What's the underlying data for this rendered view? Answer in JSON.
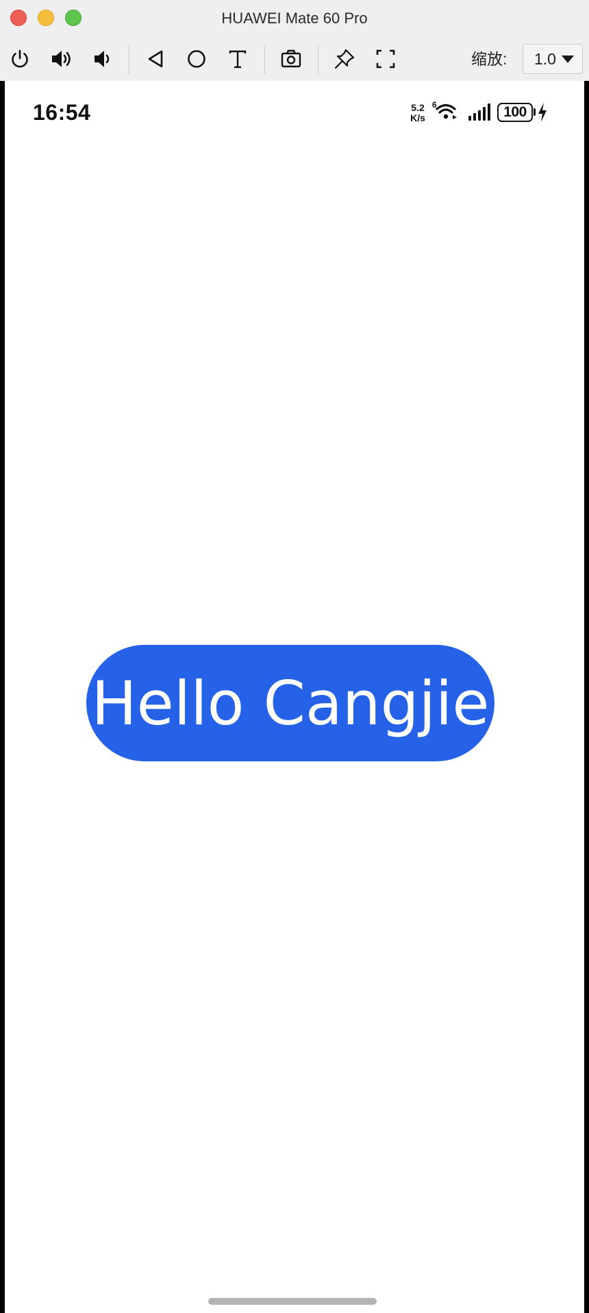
{
  "window": {
    "title": "HUAWEI Mate 60 Pro"
  },
  "toolbar": {
    "buttons": [
      {
        "name": "power-icon"
      },
      {
        "name": "volume-up-icon"
      },
      {
        "name": "volume-down-icon"
      },
      {
        "name": "back-icon"
      },
      {
        "name": "home-icon"
      },
      {
        "name": "text-input-icon"
      },
      {
        "name": "screenshot-icon"
      },
      {
        "name": "pin-icon"
      },
      {
        "name": "fullscreen-icon"
      }
    ],
    "zoom_label": "缩放:",
    "zoom_value": "1.0"
  },
  "status_bar": {
    "time": "16:54",
    "net_speed_value": "5.2",
    "net_speed_unit": "K/s",
    "wifi_badge": "6",
    "battery_level": "100"
  },
  "app": {
    "button_label": "Hello Cangjie",
    "button_color": "#2562e8"
  }
}
